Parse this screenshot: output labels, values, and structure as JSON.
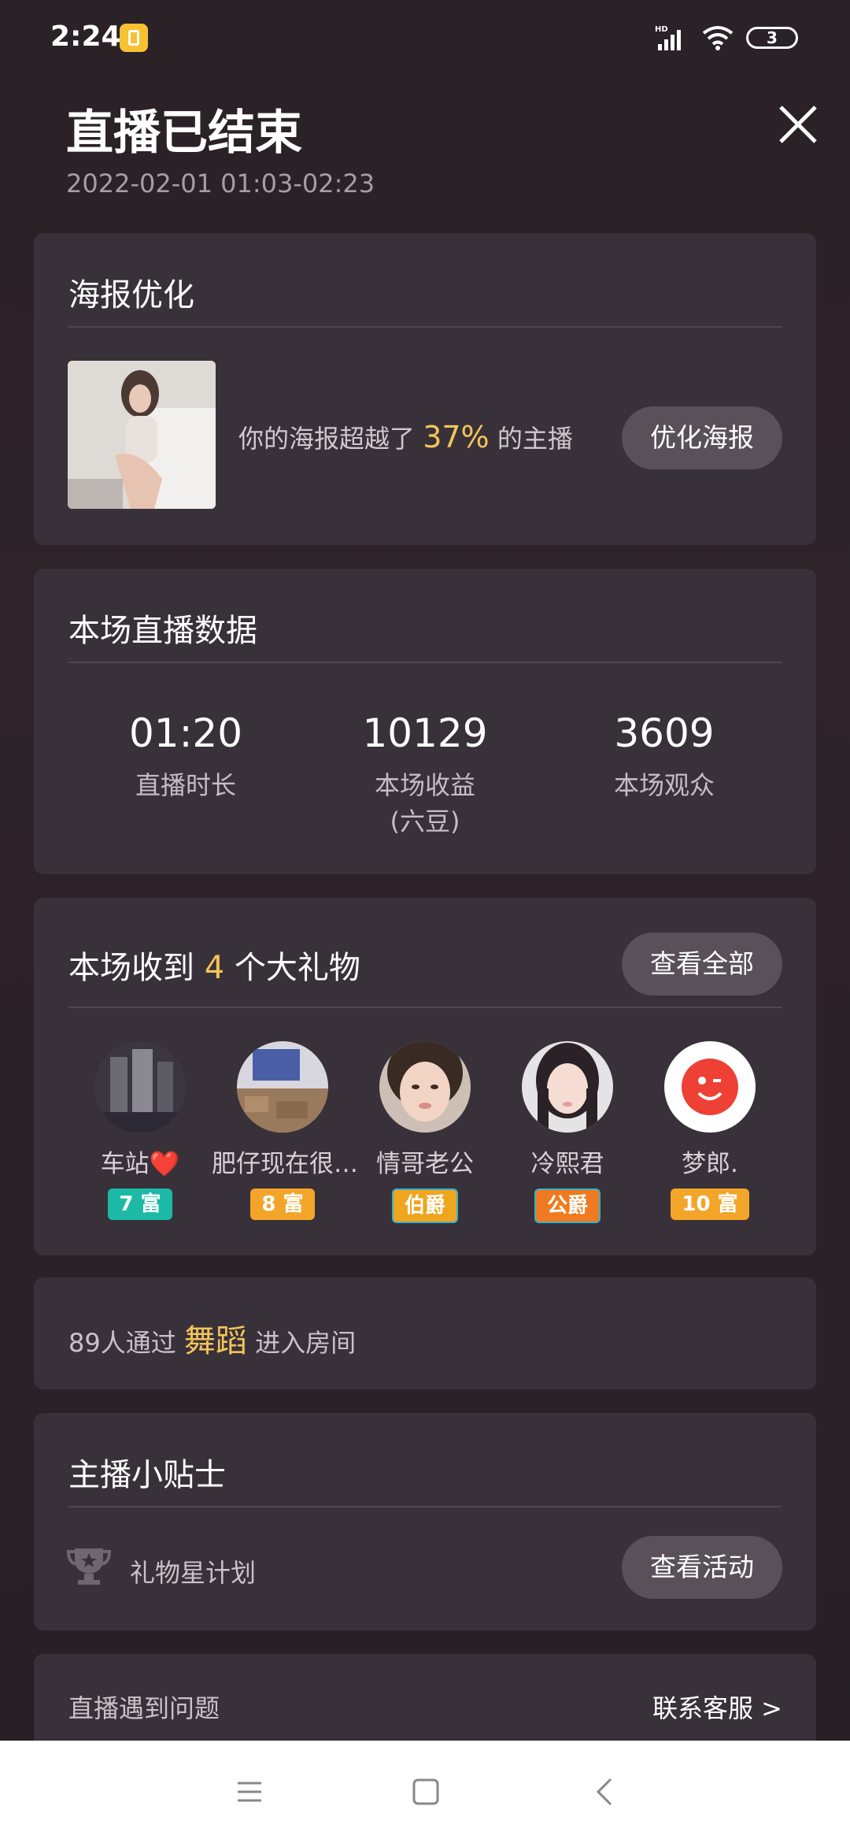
{
  "status": {
    "time": "2:24",
    "network": "HD",
    "battery": "3"
  },
  "header": {
    "title": "直播已结束",
    "subtitle": "2022-02-01 01:03-02:23"
  },
  "poster": {
    "title": "海报优化",
    "text_before": "你的海报超越了",
    "percent": "37%",
    "text_after": "的主播",
    "button": "优化海报"
  },
  "stats": {
    "title": "本场直播数据",
    "items": [
      {
        "value": "01:20",
        "label": "直播时长",
        "sub": ""
      },
      {
        "value": "10129",
        "label": "本场收益",
        "sub": "(六豆)"
      },
      {
        "value": "3609",
        "label": "本场观众",
        "sub": ""
      }
    ]
  },
  "gifts": {
    "title_before": "本场收到",
    "count": "4",
    "title_after": "个大礼物",
    "button": "查看全部",
    "users": [
      {
        "name": "车站",
        "heart": "❤️",
        "badge": "7 富",
        "badge_color": "#1bb9a6"
      },
      {
        "name": "肥仔现在很…",
        "heart": "",
        "badge": "8 富",
        "badge_color": "#f3a52a"
      },
      {
        "name": "情哥老公",
        "heart": "",
        "badge": "伯爵",
        "badge_color": "#f0a51f"
      },
      {
        "name": "冷熙君",
        "heart": "",
        "badge": "公爵",
        "badge_color": "#f07a1f"
      },
      {
        "name": "梦郎.",
        "heart": "",
        "badge": "10 富",
        "badge_color": "#f3a52a"
      }
    ]
  },
  "entry": {
    "count_text": "89人通过",
    "source": "舞蹈",
    "suffix": "进入房间"
  },
  "tips": {
    "title": "主播小贴士",
    "item": "礼物星计划",
    "button": "查看活动"
  },
  "help": {
    "label": "直播遇到问题",
    "link": "联系客服 >"
  },
  "colors": {
    "accent": "#f5c45a",
    "card": "#383139",
    "button": "#5a505a"
  }
}
